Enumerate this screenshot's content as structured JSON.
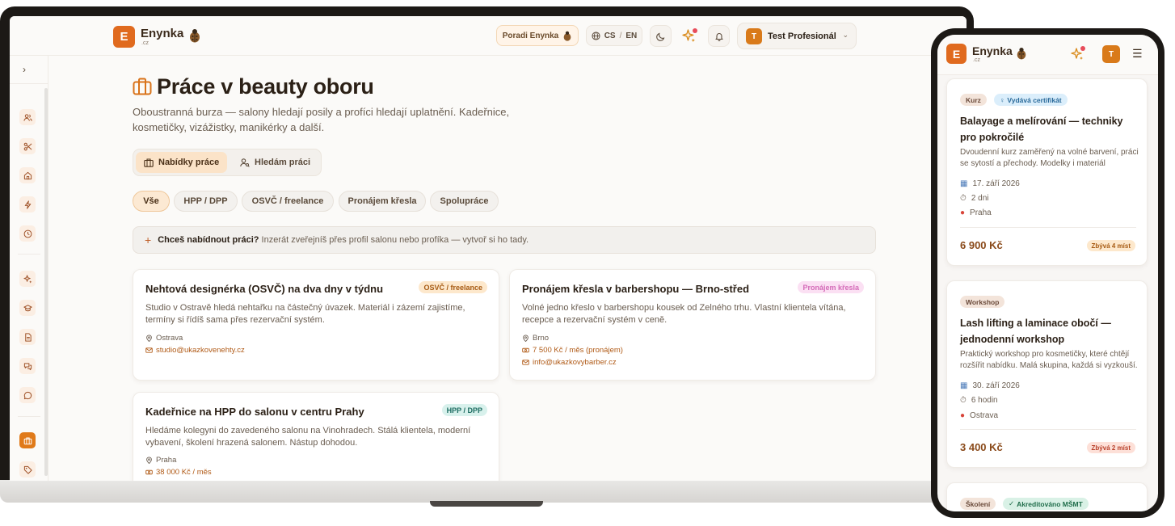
{
  "brand": {
    "name": "Enynka",
    "sub": ".cz",
    "letter": "E"
  },
  "topbar": {
    "poradi_label": "Poradi Enynka",
    "lang_cs": "CS",
    "lang_sep": "/",
    "lang_en": "EN",
    "user_initial": "T",
    "user_name": "Test Profesionál"
  },
  "page": {
    "title": "Práce v beauty oboru",
    "description": "Oboustranná burza — salony hledají posily a profíci hledají uplatnění. Kadeřnice, kosmetičky, vizážistky, manikérky a další."
  },
  "tabs": [
    {
      "label": "Nabídky práce"
    },
    {
      "label": "Hledám práci"
    }
  ],
  "filters": [
    "Vše",
    "HPP / DPP",
    "OSVČ / freelance",
    "Pronájem křesla",
    "Spolupráce"
  ],
  "offer_bar": {
    "bold": "Chceš nabídnout práci?",
    "text": "Inzerát zveřejníš přes profil salonu nebo profíka — vytvoř si ho tady."
  },
  "jobs": [
    {
      "title": "Nehtová designérka (OSVČ) na dva dny v týdnu",
      "badge": "OSVČ / freelance",
      "description": "Studio v Ostravě hledá nehtařku na částečný úvazek. Materiál i zázemí zajistíme, termíny si řídíš sama přes rezervační systém.",
      "location": "Ostrava",
      "email": "studio@ukazkovenehty.cz"
    },
    {
      "title": "Pronájem křesla v barbershopu — Brno-střed",
      "badge": "Pronájem křesla",
      "description": "Volné jedno křeslo v barbershopu kousek od Zelného trhu. Vlastní klientela vítána, recepce a rezervační systém v ceně.",
      "location": "Brno",
      "salary": "7 500 Kč / měs (pronájem)",
      "email": "info@ukazkovybarber.cz"
    },
    {
      "title": "Kadeřnice na HPP do salonu v centru Prahy",
      "badge": "HPP / DPP",
      "description": "Hledáme kolegyni do zavedeného salonu na Vinohradech. Stálá klientela, moderní vybavení, školení hrazená salonem. Nástup dohodou.",
      "location": "Praha",
      "salary": "38 000 Kč / měs"
    }
  ],
  "mobile": {
    "user_initial": "T",
    "courses": [
      {
        "type": "Kurz",
        "extra_tag": "Vydává certifikát",
        "title": "Balayage a melírování — techniky pro pokročilé",
        "description": "Dvoudenní kurz zaměřený na volné barvení, práci se sytostí a přechody. Modelky i materiál zajištěny.",
        "date": "17. září 2026",
        "duration": "2 dni",
        "location": "Praha",
        "price": "6 900 Kč",
        "left": "Zbývá 4 míst"
      },
      {
        "type": "Workshop",
        "title": "Lash lifting a laminace obočí — jednodenní workshop",
        "description": "Praktický workshop pro kosmetičky, které chtějí rozšířit nabídku. Malá skupina, každá si vyzkouší.",
        "date": "30. září 2026",
        "duration": "6 hodin",
        "location": "Ostrava",
        "price": "3 400 Kč",
        "left": "Zbývá 2 míst"
      },
      {
        "type": "Školení",
        "extra_tag": "Akreditováno MŠMT"
      }
    ]
  },
  "colors": {
    "accent": "#e06a1e",
    "background": "#fbfaf8",
    "text": "#2b2016"
  }
}
